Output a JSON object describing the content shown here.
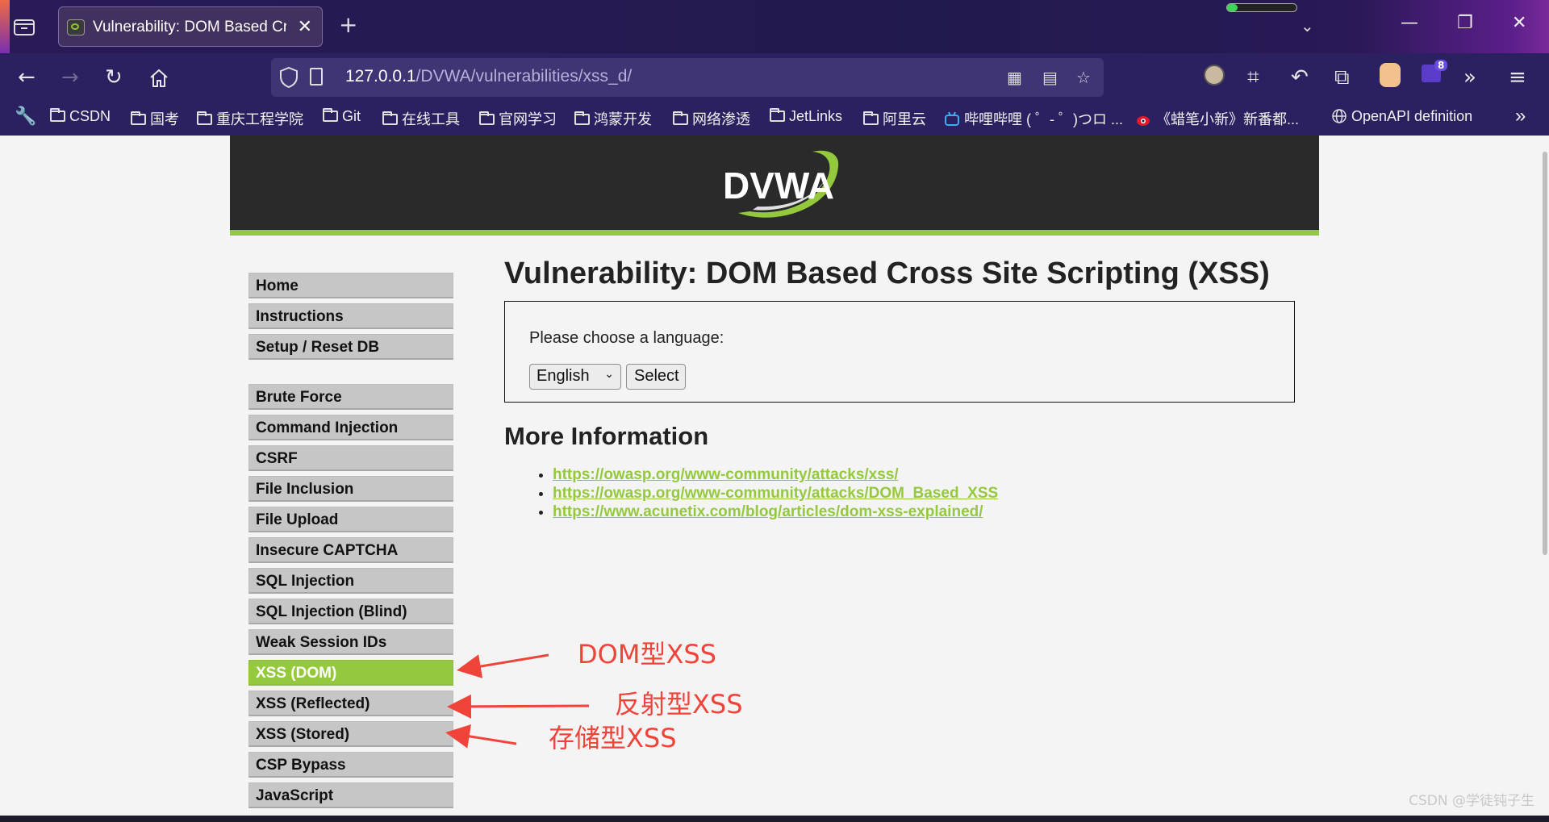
{
  "browser": {
    "tab_title": "Vulnerability: DOM Based Cro",
    "tab_close": "✕",
    "new_tab": "+",
    "loading_progress": 0.15,
    "url_host": "127.0.0.1",
    "url_path": "/DVWA/vulnerabilities/xss_d/",
    "extension_badge": "8",
    "bookmarks": [
      "CSDN",
      "国考",
      "重庆工程学院",
      "Git",
      "在线工具",
      "官网学习",
      "鸿蒙开发",
      "网络渗透",
      "JetLinks",
      "阿里云",
      "哔哩哔哩 ( ゜- ゜)つロ ...",
      "《蜡笔小新》新番都...",
      "OpenAPI definition"
    ],
    "icons": [
      "tab-list-icon",
      "back-icon",
      "forward-icon",
      "reload-icon",
      "home-icon",
      "shield-icon",
      "page-icon",
      "qr-code-icon",
      "reader-view-icon",
      "star-icon",
      "avatar-icon",
      "crop-icon",
      "undo-icon",
      "extensions-icon",
      "more-tools-icon",
      "menu-icon",
      "wrench-icon"
    ]
  },
  "page": {
    "logo_text": "DVWA",
    "menu": {
      "group1": [
        "Home",
        "Instructions",
        "Setup / Reset DB"
      ],
      "group2": [
        "Brute Force",
        "Command Injection",
        "CSRF",
        "File Inclusion",
        "File Upload",
        "Insecure CAPTCHA",
        "SQL Injection",
        "SQL Injection (Blind)",
        "Weak Session IDs",
        "XSS (DOM)",
        "XSS (Reflected)",
        "XSS (Stored)",
        "CSP Bypass",
        "JavaScript"
      ],
      "active": "XSS (DOM)"
    },
    "title": "Vulnerability: DOM Based Cross Site Scripting (XSS)",
    "form": {
      "prompt": "Please choose a language:",
      "language_selected": "English",
      "submit_label": "Select"
    },
    "more_info_title": "More Information",
    "links": [
      "https://owasp.org/www-community/attacks/xss/",
      "https://owasp.org/www-community/attacks/DOM_Based_XSS",
      "https://www.acunetix.com/blog/articles/dom-xss-explained/"
    ]
  },
  "annotations": {
    "dom": "DOM型XSS",
    "reflected": "反射型XSS",
    "stored": "存储型XSS",
    "color": "#f0443a"
  },
  "watermark": "CSDN @学徒钝子生",
  "colors": {
    "accent_green": "#95c93d",
    "header_dark": "#2a2a2a",
    "chrome_purple": "#2b2060"
  }
}
